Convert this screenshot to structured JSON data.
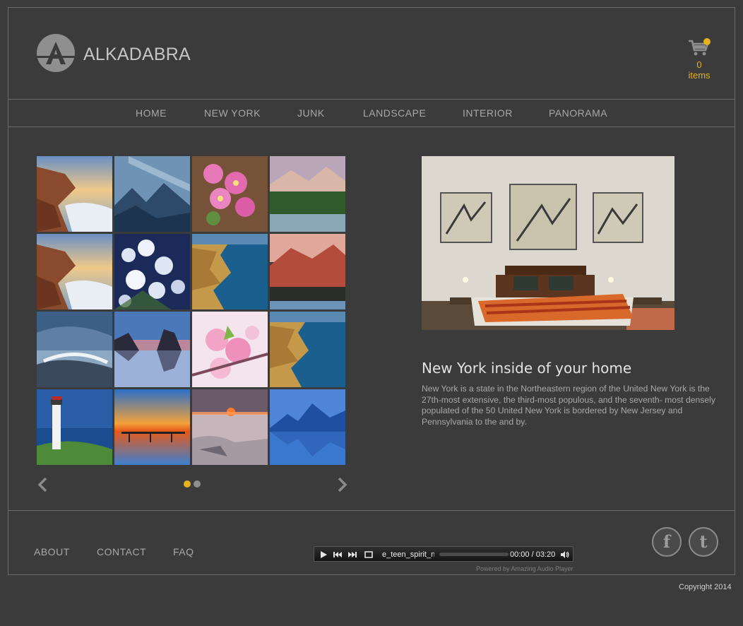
{
  "header": {
    "brand": "ALKADABRA",
    "logo_letter": "A",
    "cart": {
      "count": "0",
      "label": "items"
    }
  },
  "nav": {
    "items": [
      {
        "label": "HOME"
      },
      {
        "label": "NEW YORK"
      },
      {
        "label": "JUNK"
      },
      {
        "label": "LANDSCAPE"
      },
      {
        "label": "INTERIOR"
      },
      {
        "label": "PANORAMA"
      }
    ]
  },
  "gallery": {
    "thumbs": [
      {
        "name": "coast-sunset-rocks"
      },
      {
        "name": "misty-mountains"
      },
      {
        "name": "pink-blossom"
      },
      {
        "name": "lake-mountain-sunset"
      },
      {
        "name": "coast-sunset-rocks"
      },
      {
        "name": "white-flowers"
      },
      {
        "name": "aerial-coastline"
      },
      {
        "name": "red-mountains"
      },
      {
        "name": "stormy-sea"
      },
      {
        "name": "rock-reflection"
      },
      {
        "name": "cherry-blossom"
      },
      {
        "name": "aerial-coastline"
      },
      {
        "name": "lighthouse"
      },
      {
        "name": "pier-sunset"
      },
      {
        "name": "misty-shore"
      },
      {
        "name": "blue-mountain-lake"
      }
    ],
    "pagination": {
      "active_page": 1,
      "total_pages": 2
    }
  },
  "feature": {
    "title": "New York inside of your home",
    "text": "New York is a state in the Northeastern region of the United New York is the 27th-most extensive, the third-most populous, and the seventh- most densely populated of the 50 United New York is bordered by New Jersey and Pennsylvania to the and by."
  },
  "footer": {
    "links": [
      {
        "label": "ABOUT"
      },
      {
        "label": "CONTACT"
      },
      {
        "label": "FAQ"
      }
    ],
    "player": {
      "track": "e_teen_spirit_n",
      "time": "00:00 / 03:20",
      "powered": "Powered by Amazing Audio Player"
    },
    "social": {
      "facebook": "f",
      "twitter": "t"
    }
  },
  "copyright": "Copyright 2014",
  "colors": {
    "accent": "#e4b21c",
    "background": "#3b3b3b",
    "border": "#6a6a6a"
  }
}
